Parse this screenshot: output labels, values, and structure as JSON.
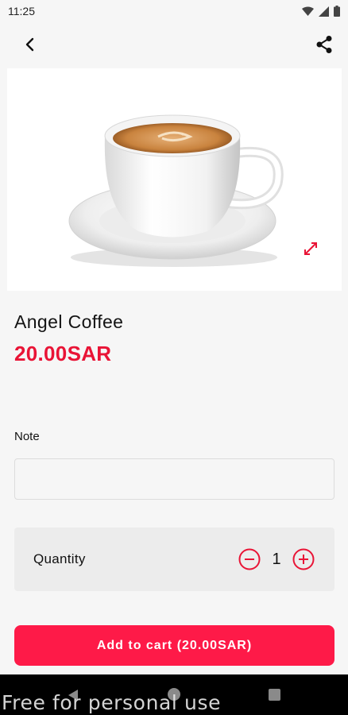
{
  "status_bar": {
    "time": "11:25",
    "icons": [
      "wifi-icon",
      "signal-icon",
      "battery-icon"
    ]
  },
  "app_bar": {
    "back_icon": "chevron-left-icon",
    "share_icon": "share-icon"
  },
  "product": {
    "image": "coffee-cup-photo",
    "expand_icon": "expand-icon",
    "name": "Angel Coffee",
    "price": "20.00SAR"
  },
  "note": {
    "label": "Note",
    "value": "",
    "placeholder": ""
  },
  "quantity": {
    "label": "Quantity",
    "value": "1",
    "decrease_icon": "minus-circle-icon",
    "increase_icon": "plus-circle-icon"
  },
  "cart_button": {
    "label": "Add to cart (20.00SAR)"
  },
  "nav_bar": {
    "icons": [
      "back-triangle-icon",
      "home-circle-icon",
      "recents-square-icon"
    ]
  },
  "watermark": {
    "text": "Free for personal use"
  },
  "colors": {
    "accent": "#e91436",
    "button": "#fe1a48",
    "card": "#ececec",
    "background": "#f6f6f6"
  }
}
